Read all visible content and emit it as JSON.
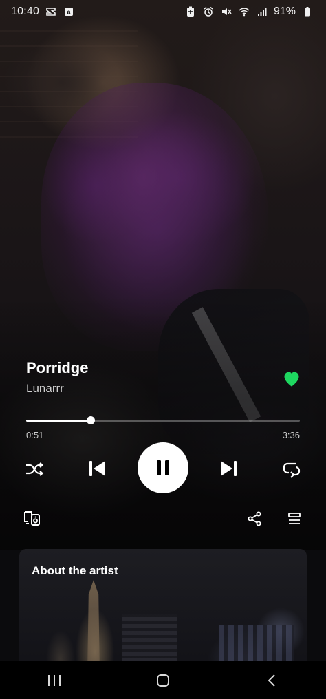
{
  "status_bar": {
    "time": "10:40",
    "battery_percent": "91%",
    "left_icons": [
      "capcut-icon",
      "amazon-icon"
    ],
    "right_icons": [
      "battery-saver-icon",
      "alarm-icon",
      "mute-icon",
      "wifi-icon",
      "signal-icon",
      "battery-icon"
    ]
  },
  "track": {
    "title": "Porridge",
    "artist": "Lunarrr",
    "liked": true
  },
  "progress": {
    "elapsed": "0:51",
    "total": "3:36",
    "fraction": 0.236
  },
  "controls": {
    "shuffle_icon": "shuffle-icon",
    "previous_icon": "skip-previous-icon",
    "play_state": "playing",
    "next_icon": "skip-next-icon",
    "repeat_icon": "repeat-icon"
  },
  "secondary": {
    "devices_icon": "connect-devices-icon",
    "share_icon": "share-icon",
    "queue_icon": "queue-icon"
  },
  "artist_section": {
    "title": "About the artist"
  },
  "nav": {
    "items": [
      "recents-icon",
      "home-icon",
      "back-icon"
    ]
  },
  "colors": {
    "accent_green": "#1ed760",
    "text_primary": "#ffffff",
    "text_secondary": "#cfcfcf"
  }
}
